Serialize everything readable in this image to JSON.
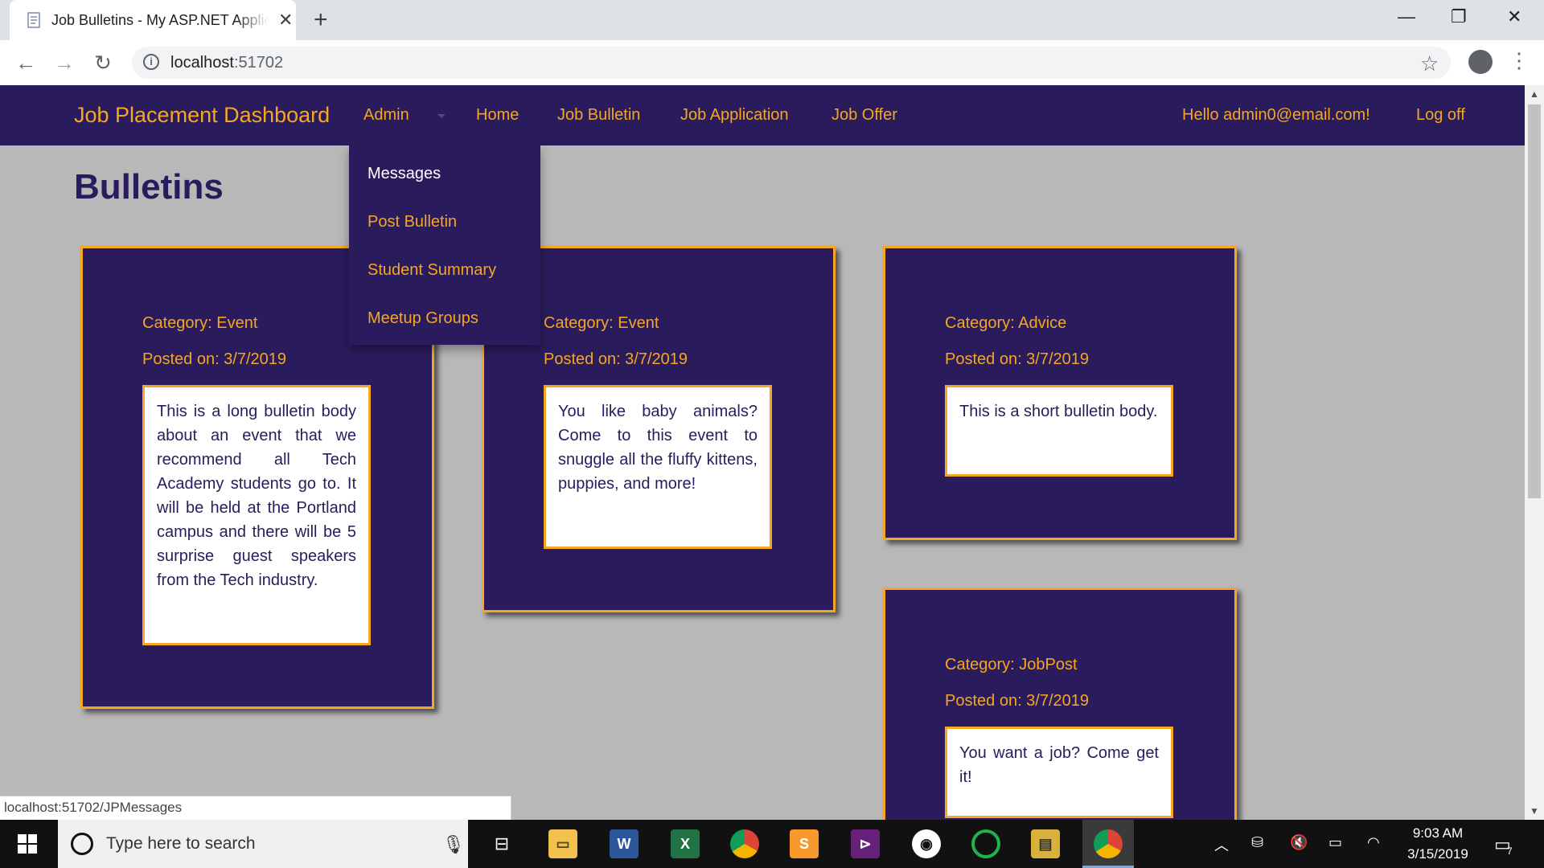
{
  "browser": {
    "tab_title": "Job Bulletins - My ASP.NET Application",
    "tab_close": "✕",
    "new_tab": "+",
    "url_host": "localhost",
    "url_port": ":51702",
    "status_url": "localhost:51702/JPMessages",
    "window_controls": {
      "minimize": "—",
      "restore": "❐",
      "close": "✕"
    }
  },
  "navbar": {
    "brand": "Job Placement Dashboard",
    "items": [
      {
        "label": "Admin"
      },
      {
        "label": "Home"
      },
      {
        "label": "Job Bulletin"
      },
      {
        "label": "Job Application"
      },
      {
        "label": "Job Offer"
      }
    ],
    "greeting": "Hello admin0@email.com!",
    "logoff": "Log off"
  },
  "admin_dropdown": {
    "items": [
      {
        "label": "Messages",
        "active": true
      },
      {
        "label": "Post Bulletin"
      },
      {
        "label": "Student Summary"
      },
      {
        "label": "Meetup Groups"
      }
    ]
  },
  "page": {
    "title": "Bulletins"
  },
  "bulletins": [
    {
      "category": "Category: Event",
      "posted": "Posted on: 3/7/2019",
      "body": "This is a long bulletin body about an event that we recommend all Tech Academy students go to. It will be held at the Portland campus and there will be 5 surprise guest speakers from the Tech industry."
    },
    {
      "category": "Category: Event",
      "posted": "Posted on: 3/7/2019",
      "body": "You like baby animals? Come to this event to snuggle all the fluffy kittens, puppies, and more!"
    },
    {
      "category": "Category: Advice",
      "posted": "Posted on: 3/7/2019",
      "body": "This is a short bulletin body."
    },
    {
      "category": "Category: JobPost",
      "posted": "Posted on: 3/7/2019",
      "body": "You want a job? Come get it!"
    }
  ],
  "taskbar": {
    "search_placeholder": "Type here to search",
    "time": "9:03 AM",
    "date": "3/15/2019",
    "notification_count": "7"
  },
  "colors": {
    "nav_bg": "#2a1b5c",
    "accent": "#f5a623",
    "page_bg": "#b8b8b8"
  }
}
